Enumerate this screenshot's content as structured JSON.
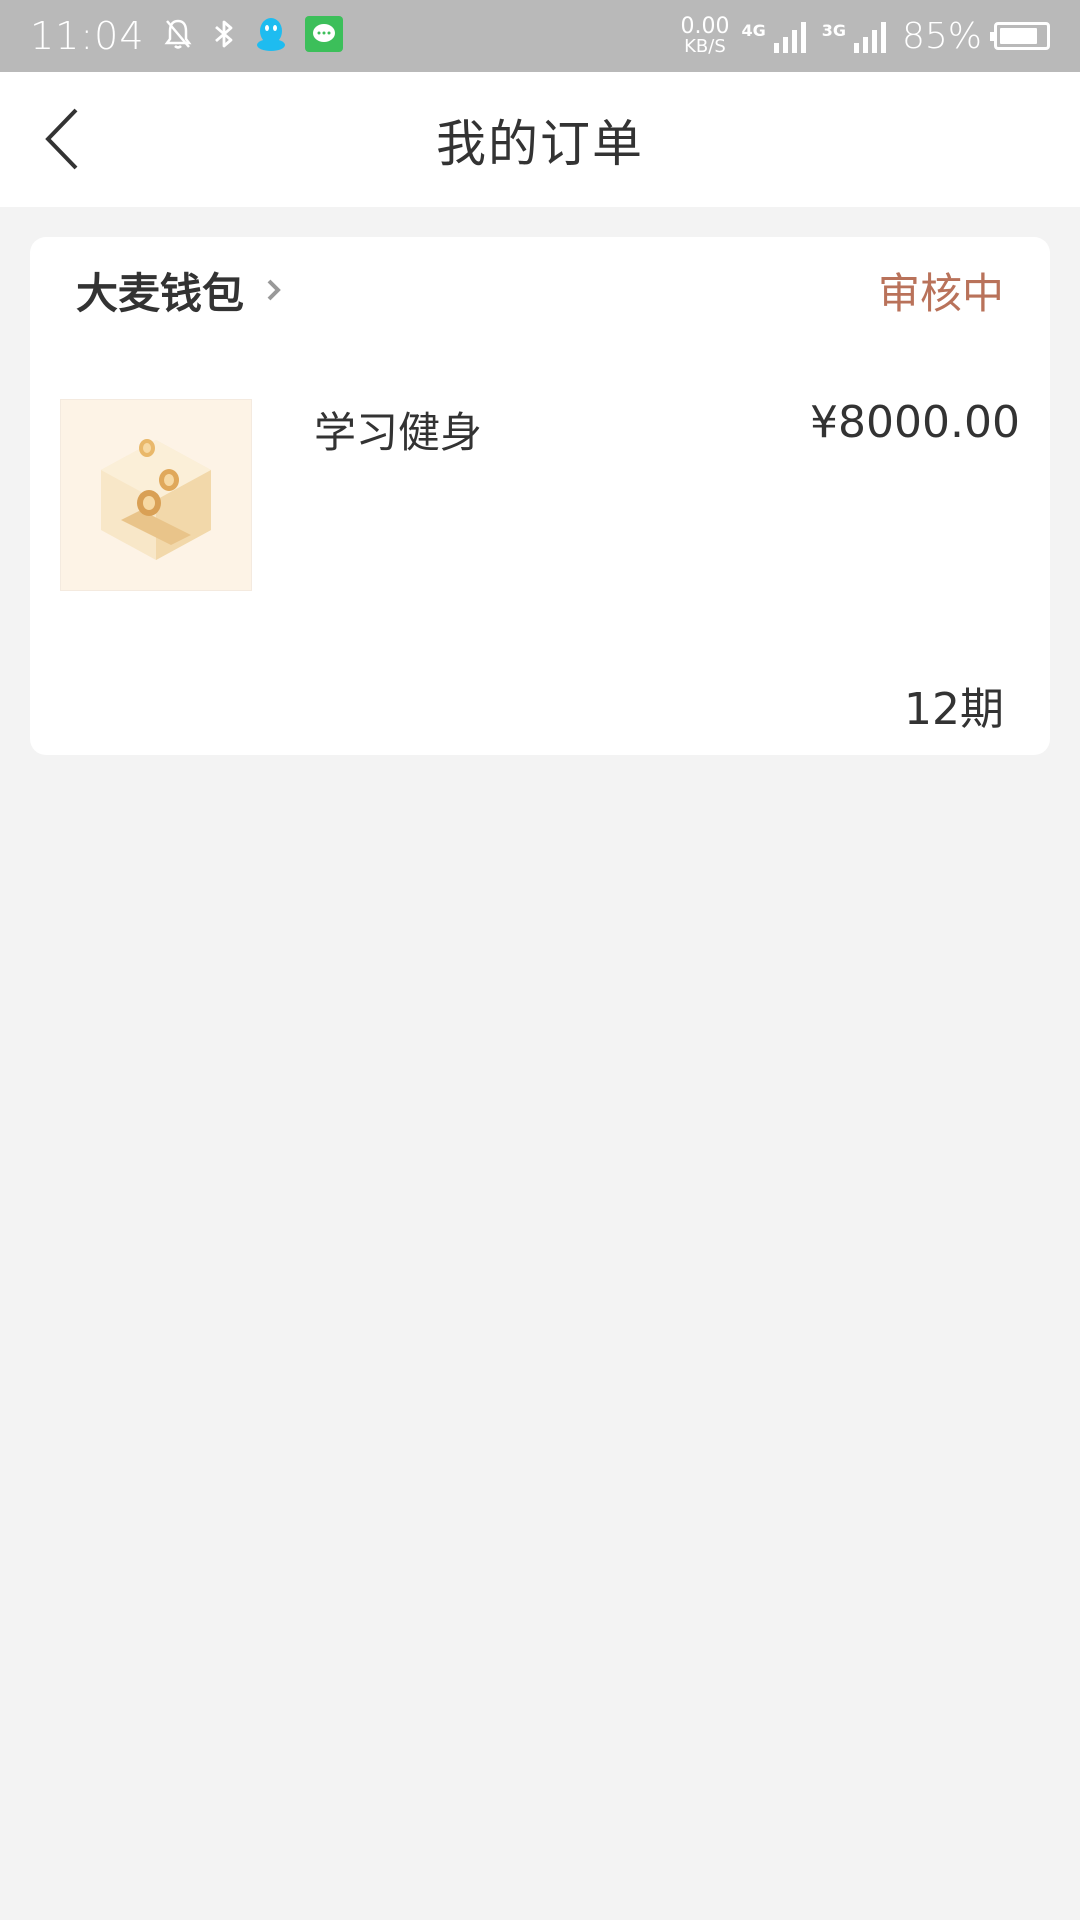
{
  "status_bar": {
    "time": "11:04",
    "net_speed_value": "0.00",
    "net_speed_unit": "KB/S",
    "sig1_label": "4G",
    "sig2_label": "3G",
    "battery_pct": "85%",
    "battery_level": 0.85
  },
  "header": {
    "title": "我的订单"
  },
  "order": {
    "merchant": "大麦钱包",
    "status": "审核中",
    "status_color": "#b9725a",
    "product_name": "学习健身",
    "price": "¥8000.00",
    "term": "12期"
  },
  "colors": {
    "status_bar_bg": "#b9b9b9",
    "page_bg": "#f3f3f3",
    "qq_icon": "#1ebcf0",
    "message_app_icon": "#3cbf5a"
  }
}
